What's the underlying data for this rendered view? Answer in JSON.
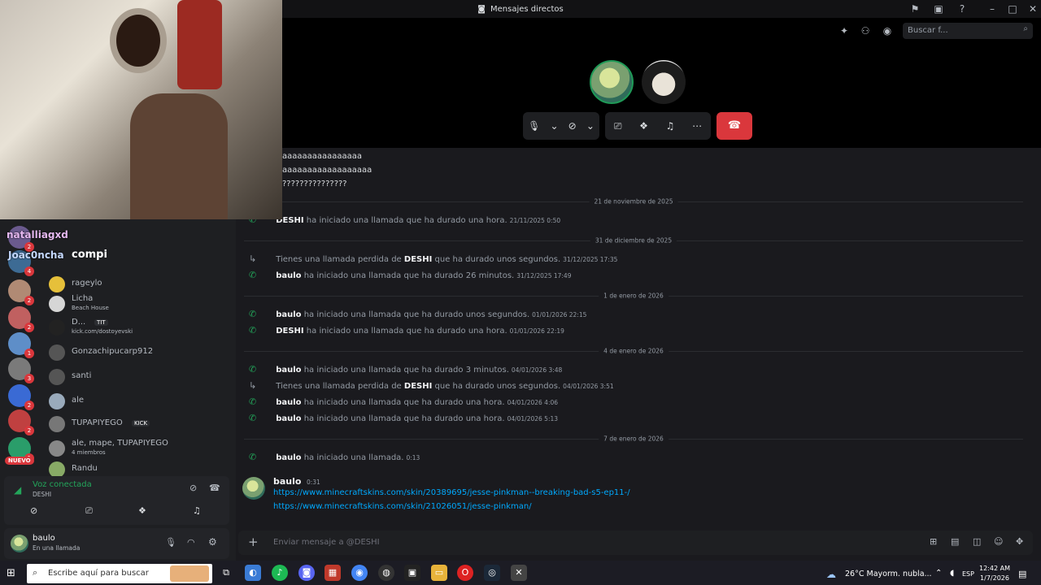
{
  "window": {
    "title": "Mensajes directos",
    "search_placeholder": "Buscar f..."
  },
  "call": {
    "icons": [
      "mic-icon",
      "chevron-down-icon",
      "camera-off-icon",
      "chevron-down-icon",
      "screen-share-icon",
      "activities-icon",
      "soundboard-icon",
      "more-icon"
    ],
    "hangup_icon": "phone-hangup-icon"
  },
  "chat": {
    "early_lines": [
      "aaaaaaaaaaaaaaaa",
      "aaaaaaaaaaaaaaaaaa",
      "???????????????"
    ],
    "groups": [
      {
        "date": "21 de noviembre de 2025",
        "items": [
          {
            "user": "DESHI",
            "pre": "",
            "text": " ha iniciado una llamada que ha durado una hora.",
            "ts": "21/11/2025 0:50",
            "missed": false
          }
        ]
      },
      {
        "date": "31 de diciembre de 2025",
        "items": [
          {
            "user": "DESHI",
            "pre": "Tienes una llamada perdida de ",
            "text": " que ha durado unos segundos.",
            "ts": "31/12/2025 17:35",
            "missed": true
          },
          {
            "user": "baulo",
            "pre": "",
            "text": " ha iniciado una llamada que ha durado 26 minutos.",
            "ts": "31/12/2025 17:49",
            "missed": false
          }
        ]
      },
      {
        "date": "1 de enero de 2026",
        "items": [
          {
            "user": "baulo",
            "pre": "",
            "text": " ha iniciado una llamada que ha durado unos segundos.",
            "ts": "01/01/2026 22:15",
            "missed": false
          },
          {
            "user": "DESHI",
            "pre": "",
            "text": " ha iniciado una llamada que ha durado una hora.",
            "ts": "01/01/2026 22:19",
            "missed": false
          }
        ]
      },
      {
        "date": "4 de enero de 2026",
        "items": [
          {
            "user": "baulo",
            "pre": "",
            "text": " ha iniciado una llamada que ha durado 3 minutos.",
            "ts": "04/01/2026 3:48",
            "missed": false
          },
          {
            "user": "DESHI",
            "pre": "Tienes una llamada perdida de ",
            "text": " que ha durado unos segundos.",
            "ts": "04/01/2026 3:51",
            "missed": true
          },
          {
            "user": "baulo",
            "pre": "",
            "text": " ha iniciado una llamada que ha durado una hora.",
            "ts": "04/01/2026 4:06",
            "missed": false
          },
          {
            "user": "baulo",
            "pre": "",
            "text": " ha iniciado una llamada que ha durado una hora.",
            "ts": "04/01/2026 5:13",
            "missed": false
          }
        ]
      },
      {
        "date": "7 de enero de 2026",
        "items": [
          {
            "user": "baulo",
            "pre": "",
            "text": " ha iniciado una llamada.",
            "ts": "0:13",
            "missed": false
          }
        ]
      }
    ],
    "last_message": {
      "user": "baulo",
      "ts": "0:31",
      "links": [
        "https://www.minecraftskins.com/skin/20389695/jesse-pinkman--breaking-bad-s5-ep11-/",
        "https://www.minecraftskins.com/skin/21026051/jesse-pinkman/"
      ]
    },
    "input_placeholder": "Enviar mensaje a @DESHI"
  },
  "sidebar": {
    "overlay": {
      "name1": "natalliagxd",
      "name2": "Joac0ncha",
      "name3": "compi"
    },
    "servers": [
      {
        "badge": "2"
      },
      {
        "badge": "4"
      },
      {
        "badge": "2"
      },
      {
        "badge": "2"
      },
      {
        "badge": "1"
      },
      {
        "badge": "3"
      },
      {
        "badge": "2"
      },
      {
        "badge": "2"
      },
      {
        "badge": "1"
      }
    ],
    "new_label": "NUEVO",
    "dms": [
      {
        "name": "rageylo",
        "sub": ""
      },
      {
        "name": "Licha",
        "sub": "Beach House"
      },
      {
        "name": "D...",
        "sub": "kick.com/dostoyevski",
        "tag": "TIT"
      },
      {
        "name": "Gonzachipucarp912",
        "sub": ""
      },
      {
        "name": "santi",
        "sub": ""
      },
      {
        "name": "ale",
        "sub": ""
      },
      {
        "name": "TUPAPIYEGO",
        "sub": "",
        "tag": "KICK"
      },
      {
        "name": "ale, mape, TUPAPIYEGO",
        "sub": "4 miembros"
      },
      {
        "name": "Randu",
        "sub": ""
      }
    ],
    "voice": {
      "status": "Voz conectada",
      "channel": "DESHI"
    },
    "user": {
      "name": "baulo",
      "status": "En una llamada"
    }
  },
  "taskbar": {
    "search_placeholder": "Escribe aquí para buscar",
    "weather": "26°C  Mayorm. nubla...",
    "lang": "ESP",
    "time": "12:42 AM",
    "date": "1/7/2026"
  },
  "colors": {
    "accent_green": "#23a55a",
    "hangup_red": "#da373c",
    "link_blue": "#00a8fc"
  }
}
